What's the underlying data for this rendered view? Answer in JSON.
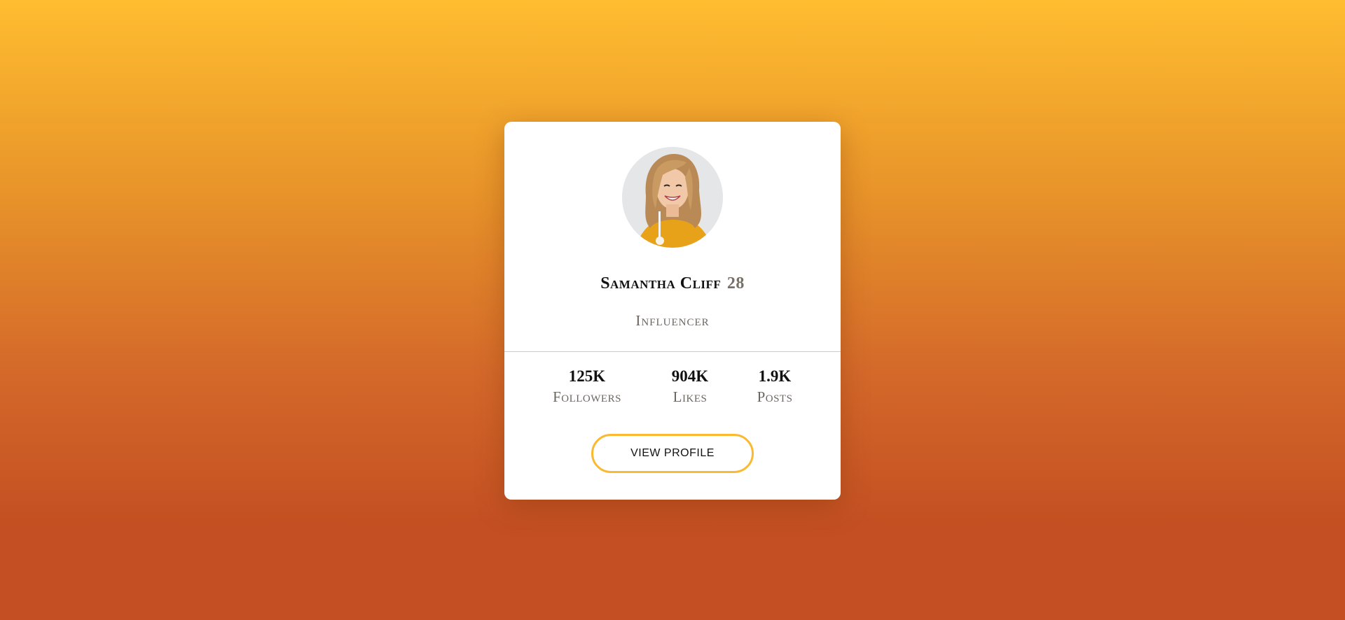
{
  "profile": {
    "name": "Samantha Cliff",
    "age": "28",
    "role": "Influencer",
    "avatar_icon": "profile-photo"
  },
  "stats": [
    {
      "value": "125K",
      "label": "Followers"
    },
    {
      "value": "904K",
      "label": "Likes"
    },
    {
      "value": "1.9K",
      "label": "Posts"
    }
  ],
  "actions": {
    "view_profile_label": "VIEW PROFILE"
  },
  "colors": {
    "accent": "#FBB931",
    "background_top": "#FFBD30",
    "background_bottom": "#C34F22",
    "card": "#FFFFFF"
  }
}
